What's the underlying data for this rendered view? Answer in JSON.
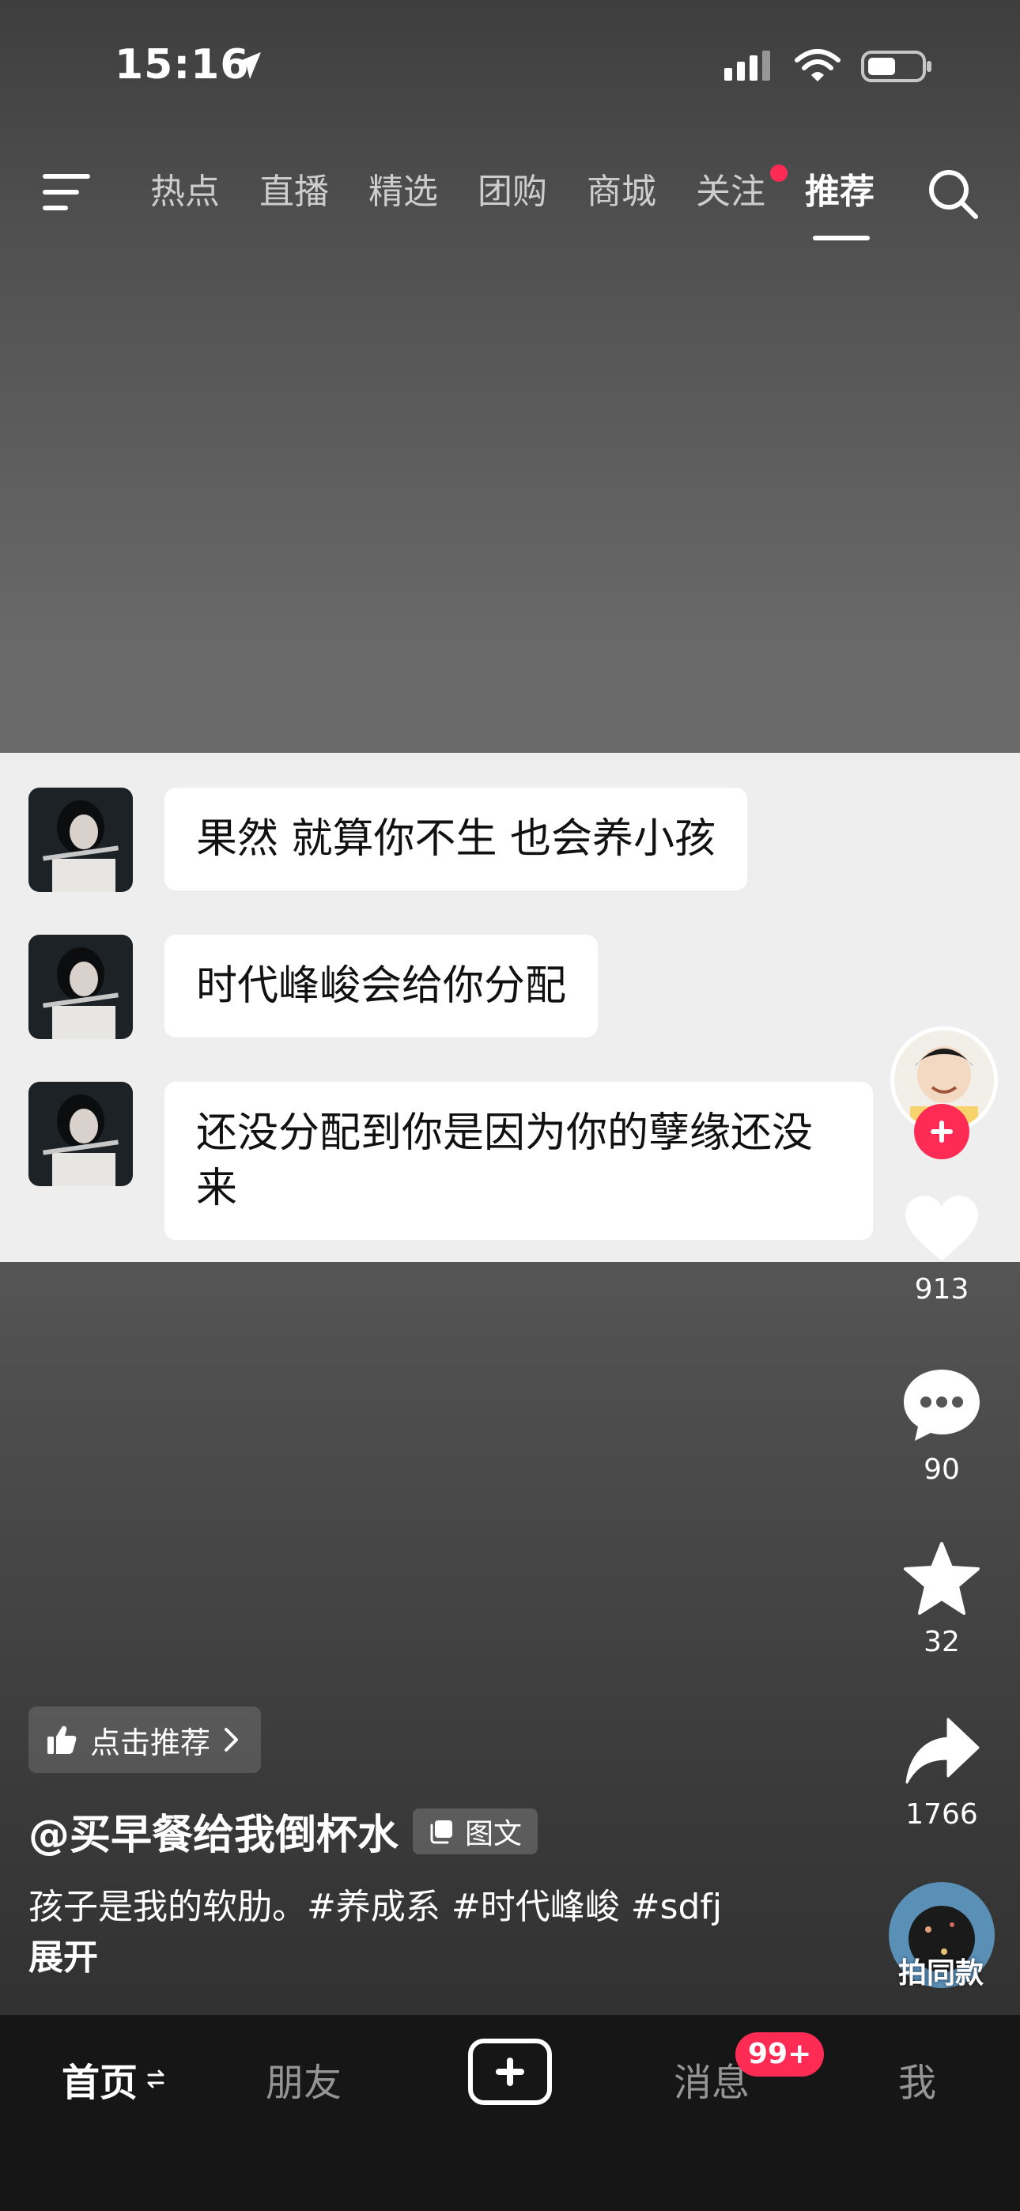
{
  "status_bar": {
    "time": "15:16"
  },
  "nav": {
    "tabs": [
      {
        "label": "热点"
      },
      {
        "label": "直播"
      },
      {
        "label": "精选"
      },
      {
        "label": "团购"
      },
      {
        "label": "商城"
      },
      {
        "label": "关注"
      },
      {
        "label": "推荐"
      }
    ],
    "active_tab": "推荐",
    "dot_on_tab": "关注"
  },
  "chat": {
    "messages": [
      {
        "text": "果然 就算你不生 也会养小孩"
      },
      {
        "text": "时代峰峻会给你分配"
      },
      {
        "text": "还没分配到你是因为你的孽缘还没来"
      }
    ]
  },
  "actions": {
    "likes": "913",
    "comments": "90",
    "favorites": "32",
    "shares": "1766"
  },
  "post": {
    "recommend_chip": "点击推荐",
    "author": "@买早餐给我倒杯水",
    "type_tag": "图文",
    "caption": "孩子是我的软肋。#养成系 #时代峰峻 #sdfj",
    "expand": "展开",
    "same_style": "拍同款"
  },
  "tabbar": {
    "home": "首页",
    "friends": "朋友",
    "messages": "消息",
    "messages_badge": "99+",
    "me": "我"
  },
  "colors": {
    "accent": "#fe2c55",
    "tabbar_bg": "#161616",
    "chat_bg": "#eeeeee"
  }
}
